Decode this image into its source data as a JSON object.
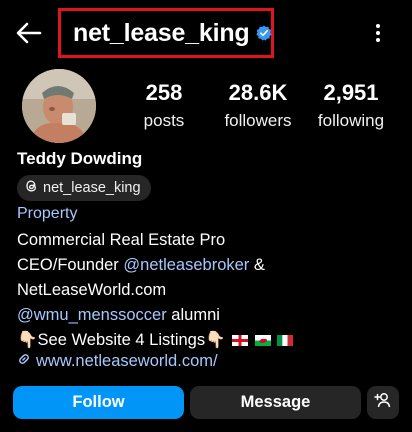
{
  "header": {
    "username": "net_lease_king",
    "icons": {
      "back": "arrow-left-icon",
      "verified": "verified-badge-icon",
      "more": "more-vertical-icon"
    },
    "colors": {
      "highlight_box": "#e0141e",
      "verified": "#3897f0"
    }
  },
  "profile": {
    "avatar_icon": "profile-photo",
    "stats": [
      {
        "value": "258",
        "label": "posts"
      },
      {
        "value": "28.6K",
        "label": "followers"
      },
      {
        "value": "2,951",
        "label": "following"
      }
    ],
    "name": "Teddy Dowding",
    "threads_handle": "net_lease_king",
    "category": "Property",
    "bio": {
      "line1": "Commercial Real Estate Pro",
      "line2_prefix": "CEO/Founder ",
      "line2_mention": "@netleasebroker",
      "line2_suffix": " &",
      "line3": "NetLeaseWorld.com",
      "line4_mention": "@wmu_menssoccer",
      "line4_suffix": " alumni",
      "line5_emoji": "👇🏻",
      "line5_text": "See Website 4 Listings",
      "line5_emoji2": "👇🏻",
      "flags": [
        "england-flag",
        "wales-flag",
        "italy-flag"
      ]
    },
    "link": "www.netleaseworld.com/"
  },
  "actions": {
    "follow": "Follow",
    "message": "Message",
    "add_user_icon": "add-user-icon",
    "colors": {
      "follow_bg": "#0095f6",
      "secondary_bg": "#262626",
      "link": "#a8c7fa"
    }
  }
}
